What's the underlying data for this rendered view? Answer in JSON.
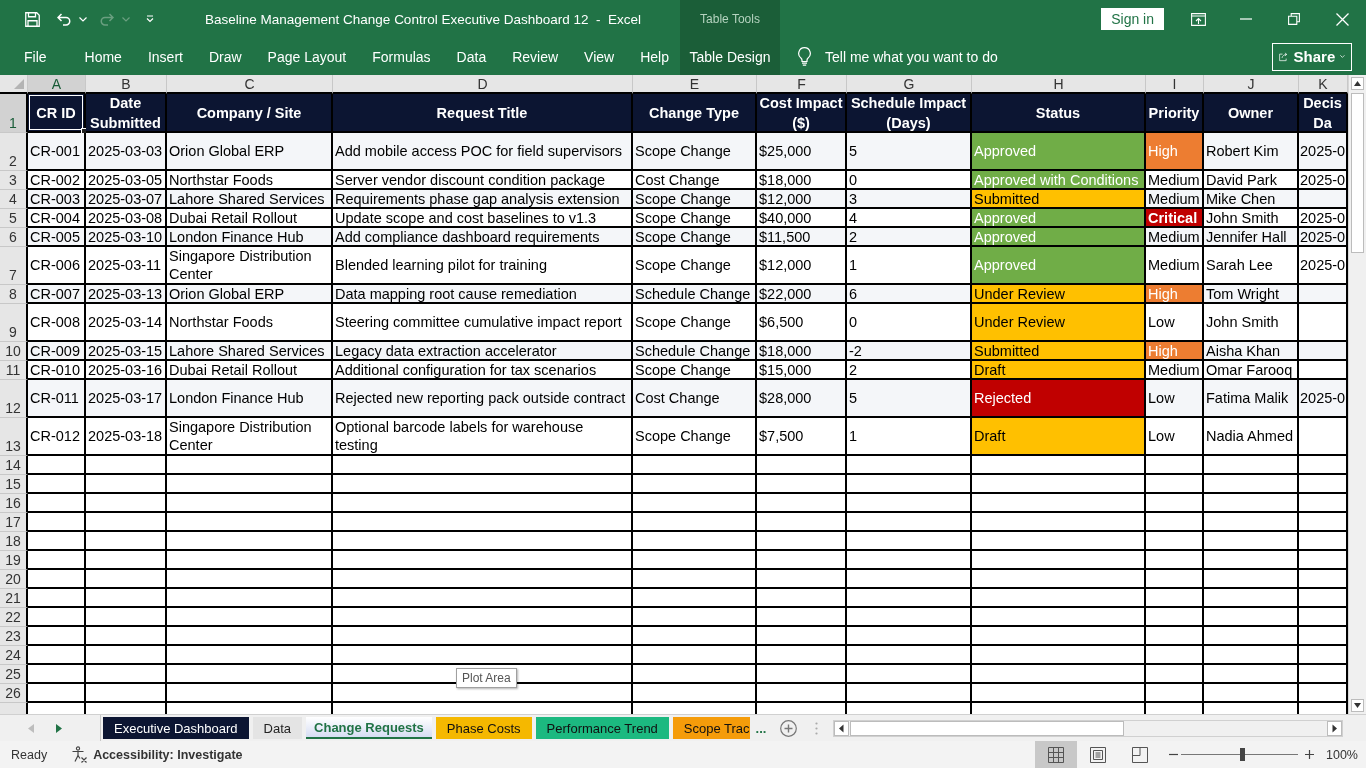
{
  "quick_access": {
    "redo_disabled": true
  },
  "title_bar": {
    "title": "Baseline Management Change Control Executive Dashboard 12  -  Excel",
    "sign_in": "Sign in"
  },
  "ribbon": {
    "tabs": [
      "File",
      "Home",
      "Insert",
      "Draw",
      "Page Layout",
      "Formulas",
      "Data",
      "Review",
      "View",
      "Help"
    ],
    "contextual_group": {
      "label": "Table Tools",
      "tab": "Table Design"
    },
    "tell_me": "Tell me what you want to do",
    "share": "Share"
  },
  "sheet": {
    "column_headers": [
      {
        "label": "A",
        "selected": true
      },
      {
        "label": "B",
        "selected": false
      },
      {
        "label": "C",
        "selected": false
      },
      {
        "label": "D",
        "selected": false
      },
      {
        "label": "E",
        "selected": false
      },
      {
        "label": "F",
        "selected": false
      },
      {
        "label": "G",
        "selected": false
      },
      {
        "label": "H",
        "selected": false
      },
      {
        "label": "I",
        "selected": false
      },
      {
        "label": "J",
        "selected": false
      },
      {
        "label": "K",
        "selected": false
      }
    ],
    "row_headers": [
      {
        "label": "1",
        "selected": true
      },
      {
        "label": "2",
        "selected": false
      },
      {
        "label": "3",
        "selected": false
      },
      {
        "label": "4",
        "selected": false
      },
      {
        "label": "5",
        "selected": false
      },
      {
        "label": "6",
        "selected": false
      },
      {
        "label": "7",
        "selected": false
      },
      {
        "label": "8",
        "selected": false
      },
      {
        "label": "9",
        "selected": false
      },
      {
        "label": "10",
        "selected": false
      },
      {
        "label": "11",
        "selected": false
      },
      {
        "label": "12",
        "selected": false
      },
      {
        "label": "13",
        "selected": false
      },
      {
        "label": "14",
        "selected": false
      },
      {
        "label": "15",
        "selected": false
      },
      {
        "label": "16",
        "selected": false
      },
      {
        "label": "17",
        "selected": false
      },
      {
        "label": "18",
        "selected": false
      },
      {
        "label": "19",
        "selected": false
      },
      {
        "label": "20",
        "selected": false
      },
      {
        "label": "21",
        "selected": false
      },
      {
        "label": "22",
        "selected": false
      },
      {
        "label": "23",
        "selected": false
      },
      {
        "label": "24",
        "selected": false
      },
      {
        "label": "25",
        "selected": false
      },
      {
        "label": "26",
        "selected": false
      }
    ],
    "columns": [
      "CR ID",
      "Date Submitted",
      "Company / Site",
      "Request Title",
      "Change Type",
      "Cost Impact ($)",
      "Schedule Impact (Days)",
      "Status",
      "Priority",
      "Owner",
      "Decis Da"
    ],
    "rows": [
      {
        "cr_id": "CR-001",
        "date_submitted": "2025-03-03",
        "company_site": "Orion Global ERP",
        "request_title": "Add mobile access POC for field supervisors",
        "change_type": "Scope Change",
        "cost_impact": "$25,000",
        "schedule_impact": "5",
        "status": {
          "text": "Approved",
          "color": "#70ad47"
        },
        "priority": {
          "text": "High",
          "color": "#ed7d31",
          "bold": false
        },
        "owner": "Robert Kim",
        "column_k": "2025-0"
      },
      {
        "cr_id": "CR-002",
        "date_submitted": "2025-03-05",
        "company_site": "Northstar Foods",
        "request_title": "Server vendor discount condition package",
        "change_type": "Cost Change",
        "cost_impact": "$18,000",
        "schedule_impact": "0",
        "status": {
          "text": "Approved with Conditions",
          "color": "#70ad47"
        },
        "priority": {
          "text": "Medium",
          "bold": false
        },
        "owner": "David Park",
        "column_k": "2025-0"
      },
      {
        "cr_id": "CR-003",
        "date_submitted": "2025-03-07",
        "company_site": "Lahore Shared Services",
        "request_title": "Requirements phase gap analysis extension",
        "change_type": "Scope Change",
        "cost_impact": "$12,000",
        "schedule_impact": "3",
        "status": {
          "text": "Submitted",
          "color": "#ffc000"
        },
        "priority": {
          "text": "Medium",
          "bold": false
        },
        "owner": "Mike Chen"
      },
      {
        "cr_id": "CR-004",
        "date_submitted": "2025-03-08",
        "company_site": "Dubai Retail Rollout",
        "request_title": "Update scope and cost baselines to v1.3",
        "change_type": "Scope Change",
        "cost_impact": "$40,000",
        "schedule_impact": "4",
        "status": {
          "text": "Approved",
          "color": "#70ad47"
        },
        "priority": {
          "text": "Critical",
          "color": "#c00000",
          "bold": true
        },
        "owner": "John Smith",
        "column_k": "2025-0"
      },
      {
        "cr_id": "CR-005",
        "date_submitted": "2025-03-10",
        "company_site": "London Finance Hub",
        "request_title": "Add compliance dashboard requirements",
        "change_type": "Scope Change",
        "cost_impact": "$11,500",
        "schedule_impact": "2",
        "status": {
          "text": "Approved",
          "color": "#70ad47"
        },
        "priority": {
          "text": "Medium",
          "bold": false
        },
        "owner": "Jennifer Hall",
        "column_k": "2025-0"
      },
      {
        "cr_id": "CR-006",
        "date_submitted": "2025-03-11",
        "company_site": "Singapore Distribution Center",
        "request_title": "Blended learning pilot for training",
        "change_type": "Scope Change",
        "cost_impact": "$12,000",
        "schedule_impact": "1",
        "status": {
          "text": "Approved",
          "color": "#70ad47"
        },
        "priority": {
          "text": "Medium",
          "bold": false
        },
        "owner": "Sarah Lee",
        "column_k": "2025-0"
      },
      {
        "cr_id": "CR-007",
        "date_submitted": "2025-03-13",
        "company_site": "Orion Global ERP",
        "request_title": "Data mapping root cause remediation",
        "change_type": "Schedule Change",
        "cost_impact": "$22,000",
        "schedule_impact": "6",
        "status": {
          "text": "Under Review",
          "color": "#ffc000"
        },
        "priority": {
          "text": "High",
          "color": "#ed7d31",
          "bold": false
        },
        "owner": "Tom Wright"
      },
      {
        "cr_id": "CR-008",
        "date_submitted": "2025-03-14",
        "company_site": "Northstar Foods",
        "request_title": "Steering committee cumulative impact report",
        "change_type": "Scope Change",
        "cost_impact": "$6,500",
        "schedule_impact": "0",
        "status": {
          "text": "Under Review",
          "color": "#ffc000"
        },
        "priority": {
          "text": "Low",
          "bold": false
        },
        "owner": "John Smith"
      },
      {
        "cr_id": "CR-009",
        "date_submitted": "2025-03-15",
        "company_site": "Lahore Shared Services",
        "request_title": "Legacy data extraction accelerator",
        "change_type": "Schedule Change",
        "cost_impact": "$18,000",
        "schedule_impact": "-2",
        "status": {
          "text": "Submitted",
          "color": "#ffc000"
        },
        "priority": {
          "text": "High",
          "color": "#ed7d31",
          "bold": false
        },
        "owner": "Aisha Khan"
      },
      {
        "cr_id": "CR-010",
        "date_submitted": "2025-03-16",
        "company_site": "Dubai Retail Rollout",
        "request_title": "Additional configuration for tax scenarios",
        "change_type": "Scope Change",
        "cost_impact": "$15,000",
        "schedule_impact": "2",
        "status": {
          "text": "Draft",
          "color": "#ffc000"
        },
        "priority": {
          "text": "Medium",
          "bold": false
        },
        "owner": "Omar Farooq"
      },
      {
        "cr_id": "CR-011",
        "date_submitted": "2025-03-17",
        "company_site": "London Finance Hub",
        "request_title": "Rejected new reporting pack outside contract",
        "change_type": "Cost Change",
        "cost_impact": "$28,000",
        "schedule_impact": "5",
        "status": {
          "text": "Rejected",
          "color": "#c00000"
        },
        "priority": {
          "text": "Low",
          "bold": false
        },
        "owner": "Fatima Malik",
        "column_k": "2025-0"
      },
      {
        "cr_id": "CR-012",
        "date_submitted": "2025-03-18",
        "company_site": "Singapore Distribution Center",
        "request_title": "Optional barcode labels for warehouse testing",
        "change_type": "Scope Change",
        "cost_impact": "$7,500",
        "schedule_impact": "1",
        "status": {
          "text": "Draft",
          "color": "#ffc000"
        },
        "priority": {
          "text": "Low",
          "bold": false
        },
        "owner": "Nadia Ahmed"
      }
    ],
    "tooltip": "Plot Area"
  },
  "sheet_tabs": {
    "tabs": [
      {
        "label": "Executive Dashboard",
        "color": "#0c1532",
        "selected": false
      },
      {
        "label": "Data",
        "selected": false
      },
      {
        "label": "Change Requests",
        "selected": true
      },
      {
        "label": "Phase Costs",
        "color": "#f5b800",
        "selected": false
      },
      {
        "label": "Performance Trend",
        "color": "#1cb980",
        "selected": false
      },
      {
        "label": "Scope Trac",
        "color": "#f59c0a",
        "selected": false
      }
    ],
    "overflow": "..."
  },
  "status_bar": {
    "mode": "Ready",
    "accessibility": "Accessibility: Investigate",
    "views": [
      {
        "kind": "normal",
        "selected": true
      },
      {
        "kind": "page_layout",
        "selected": false
      },
      {
        "kind": "page_break",
        "selected": false
      }
    ],
    "zoom": {
      "level": 0.52,
      "reading": "100%"
    }
  }
}
